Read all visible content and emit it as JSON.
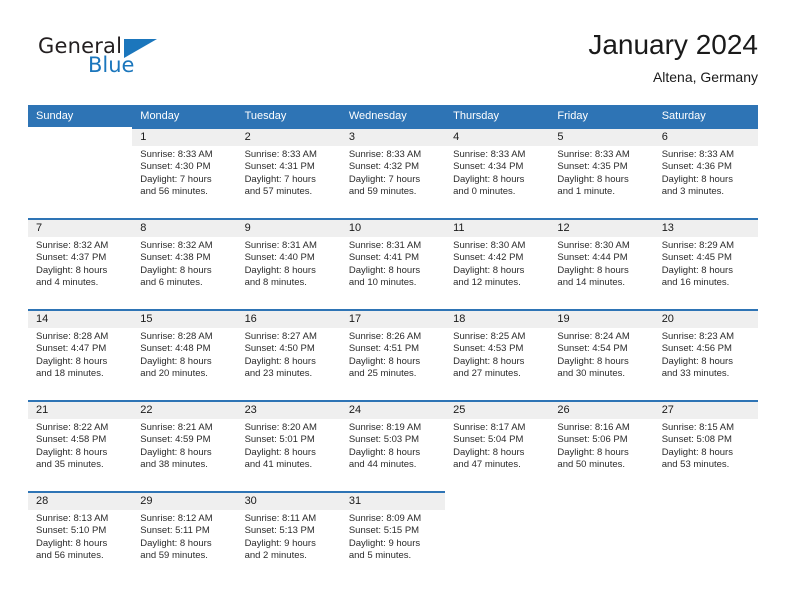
{
  "brand": {
    "name_part1": "General",
    "name_part2": "Blue",
    "triangle_icon": "triangle-logo-icon"
  },
  "header": {
    "title": "January 2024",
    "location": "Altena, Germany"
  },
  "colors": {
    "header_blue": "#2e74b5",
    "brand_blue": "#1b76bc",
    "daynum_band": "#efefef",
    "text": "#1a1a1a"
  },
  "calendar": {
    "weekday_headers": [
      "Sunday",
      "Monday",
      "Tuesday",
      "Wednesday",
      "Thursday",
      "Friday",
      "Saturday"
    ],
    "weeks": [
      [
        {
          "day": "",
          "sunrise": "",
          "sunset": "",
          "daylight_line1": "",
          "daylight_line2": "",
          "empty": true
        },
        {
          "day": "1",
          "sunrise": "Sunrise: 8:33 AM",
          "sunset": "Sunset: 4:30 PM",
          "daylight_line1": "Daylight: 7 hours",
          "daylight_line2": "and 56 minutes.",
          "empty": false
        },
        {
          "day": "2",
          "sunrise": "Sunrise: 8:33 AM",
          "sunset": "Sunset: 4:31 PM",
          "daylight_line1": "Daylight: 7 hours",
          "daylight_line2": "and 57 minutes.",
          "empty": false
        },
        {
          "day": "3",
          "sunrise": "Sunrise: 8:33 AM",
          "sunset": "Sunset: 4:32 PM",
          "daylight_line1": "Daylight: 7 hours",
          "daylight_line2": "and 59 minutes.",
          "empty": false
        },
        {
          "day": "4",
          "sunrise": "Sunrise: 8:33 AM",
          "sunset": "Sunset: 4:34 PM",
          "daylight_line1": "Daylight: 8 hours",
          "daylight_line2": "and 0 minutes.",
          "empty": false
        },
        {
          "day": "5",
          "sunrise": "Sunrise: 8:33 AM",
          "sunset": "Sunset: 4:35 PM",
          "daylight_line1": "Daylight: 8 hours",
          "daylight_line2": "and 1 minute.",
          "empty": false
        },
        {
          "day": "6",
          "sunrise": "Sunrise: 8:33 AM",
          "sunset": "Sunset: 4:36 PM",
          "daylight_line1": "Daylight: 8 hours",
          "daylight_line2": "and 3 minutes.",
          "empty": false
        }
      ],
      [
        {
          "day": "7",
          "sunrise": "Sunrise: 8:32 AM",
          "sunset": "Sunset: 4:37 PM",
          "daylight_line1": "Daylight: 8 hours",
          "daylight_line2": "and 4 minutes.",
          "empty": false
        },
        {
          "day": "8",
          "sunrise": "Sunrise: 8:32 AM",
          "sunset": "Sunset: 4:38 PM",
          "daylight_line1": "Daylight: 8 hours",
          "daylight_line2": "and 6 minutes.",
          "empty": false
        },
        {
          "day": "9",
          "sunrise": "Sunrise: 8:31 AM",
          "sunset": "Sunset: 4:40 PM",
          "daylight_line1": "Daylight: 8 hours",
          "daylight_line2": "and 8 minutes.",
          "empty": false
        },
        {
          "day": "10",
          "sunrise": "Sunrise: 8:31 AM",
          "sunset": "Sunset: 4:41 PM",
          "daylight_line1": "Daylight: 8 hours",
          "daylight_line2": "and 10 minutes.",
          "empty": false
        },
        {
          "day": "11",
          "sunrise": "Sunrise: 8:30 AM",
          "sunset": "Sunset: 4:42 PM",
          "daylight_line1": "Daylight: 8 hours",
          "daylight_line2": "and 12 minutes.",
          "empty": false
        },
        {
          "day": "12",
          "sunrise": "Sunrise: 8:30 AM",
          "sunset": "Sunset: 4:44 PM",
          "daylight_line1": "Daylight: 8 hours",
          "daylight_line2": "and 14 minutes.",
          "empty": false
        },
        {
          "day": "13",
          "sunrise": "Sunrise: 8:29 AM",
          "sunset": "Sunset: 4:45 PM",
          "daylight_line1": "Daylight: 8 hours",
          "daylight_line2": "and 16 minutes.",
          "empty": false
        }
      ],
      [
        {
          "day": "14",
          "sunrise": "Sunrise: 8:28 AM",
          "sunset": "Sunset: 4:47 PM",
          "daylight_line1": "Daylight: 8 hours",
          "daylight_line2": "and 18 minutes.",
          "empty": false
        },
        {
          "day": "15",
          "sunrise": "Sunrise: 8:28 AM",
          "sunset": "Sunset: 4:48 PM",
          "daylight_line1": "Daylight: 8 hours",
          "daylight_line2": "and 20 minutes.",
          "empty": false
        },
        {
          "day": "16",
          "sunrise": "Sunrise: 8:27 AM",
          "sunset": "Sunset: 4:50 PM",
          "daylight_line1": "Daylight: 8 hours",
          "daylight_line2": "and 23 minutes.",
          "empty": false
        },
        {
          "day": "17",
          "sunrise": "Sunrise: 8:26 AM",
          "sunset": "Sunset: 4:51 PM",
          "daylight_line1": "Daylight: 8 hours",
          "daylight_line2": "and 25 minutes.",
          "empty": false
        },
        {
          "day": "18",
          "sunrise": "Sunrise: 8:25 AM",
          "sunset": "Sunset: 4:53 PM",
          "daylight_line1": "Daylight: 8 hours",
          "daylight_line2": "and 27 minutes.",
          "empty": false
        },
        {
          "day": "19",
          "sunrise": "Sunrise: 8:24 AM",
          "sunset": "Sunset: 4:54 PM",
          "daylight_line1": "Daylight: 8 hours",
          "daylight_line2": "and 30 minutes.",
          "empty": false
        },
        {
          "day": "20",
          "sunrise": "Sunrise: 8:23 AM",
          "sunset": "Sunset: 4:56 PM",
          "daylight_line1": "Daylight: 8 hours",
          "daylight_line2": "and 33 minutes.",
          "empty": false
        }
      ],
      [
        {
          "day": "21",
          "sunrise": "Sunrise: 8:22 AM",
          "sunset": "Sunset: 4:58 PM",
          "daylight_line1": "Daylight: 8 hours",
          "daylight_line2": "and 35 minutes.",
          "empty": false
        },
        {
          "day": "22",
          "sunrise": "Sunrise: 8:21 AM",
          "sunset": "Sunset: 4:59 PM",
          "daylight_line1": "Daylight: 8 hours",
          "daylight_line2": "and 38 minutes.",
          "empty": false
        },
        {
          "day": "23",
          "sunrise": "Sunrise: 8:20 AM",
          "sunset": "Sunset: 5:01 PM",
          "daylight_line1": "Daylight: 8 hours",
          "daylight_line2": "and 41 minutes.",
          "empty": false
        },
        {
          "day": "24",
          "sunrise": "Sunrise: 8:19 AM",
          "sunset": "Sunset: 5:03 PM",
          "daylight_line1": "Daylight: 8 hours",
          "daylight_line2": "and 44 minutes.",
          "empty": false
        },
        {
          "day": "25",
          "sunrise": "Sunrise: 8:17 AM",
          "sunset": "Sunset: 5:04 PM",
          "daylight_line1": "Daylight: 8 hours",
          "daylight_line2": "and 47 minutes.",
          "empty": false
        },
        {
          "day": "26",
          "sunrise": "Sunrise: 8:16 AM",
          "sunset": "Sunset: 5:06 PM",
          "daylight_line1": "Daylight: 8 hours",
          "daylight_line2": "and 50 minutes.",
          "empty": false
        },
        {
          "day": "27",
          "sunrise": "Sunrise: 8:15 AM",
          "sunset": "Sunset: 5:08 PM",
          "daylight_line1": "Daylight: 8 hours",
          "daylight_line2": "and 53 minutes.",
          "empty": false
        }
      ],
      [
        {
          "day": "28",
          "sunrise": "Sunrise: 8:13 AM",
          "sunset": "Sunset: 5:10 PM",
          "daylight_line1": "Daylight: 8 hours",
          "daylight_line2": "and 56 minutes.",
          "empty": false
        },
        {
          "day": "29",
          "sunrise": "Sunrise: 8:12 AM",
          "sunset": "Sunset: 5:11 PM",
          "daylight_line1": "Daylight: 8 hours",
          "daylight_line2": "and 59 minutes.",
          "empty": false
        },
        {
          "day": "30",
          "sunrise": "Sunrise: 8:11 AM",
          "sunset": "Sunset: 5:13 PM",
          "daylight_line1": "Daylight: 9 hours",
          "daylight_line2": "and 2 minutes.",
          "empty": false
        },
        {
          "day": "31",
          "sunrise": "Sunrise: 8:09 AM",
          "sunset": "Sunset: 5:15 PM",
          "daylight_line1": "Daylight: 9 hours",
          "daylight_line2": "and 5 minutes.",
          "empty": false
        },
        {
          "day": "",
          "sunrise": "",
          "sunset": "",
          "daylight_line1": "",
          "daylight_line2": "",
          "empty": true
        },
        {
          "day": "",
          "sunrise": "",
          "sunset": "",
          "daylight_line1": "",
          "daylight_line2": "",
          "empty": true
        },
        {
          "day": "",
          "sunrise": "",
          "sunset": "",
          "daylight_line1": "",
          "daylight_line2": "",
          "empty": true
        }
      ]
    ]
  }
}
